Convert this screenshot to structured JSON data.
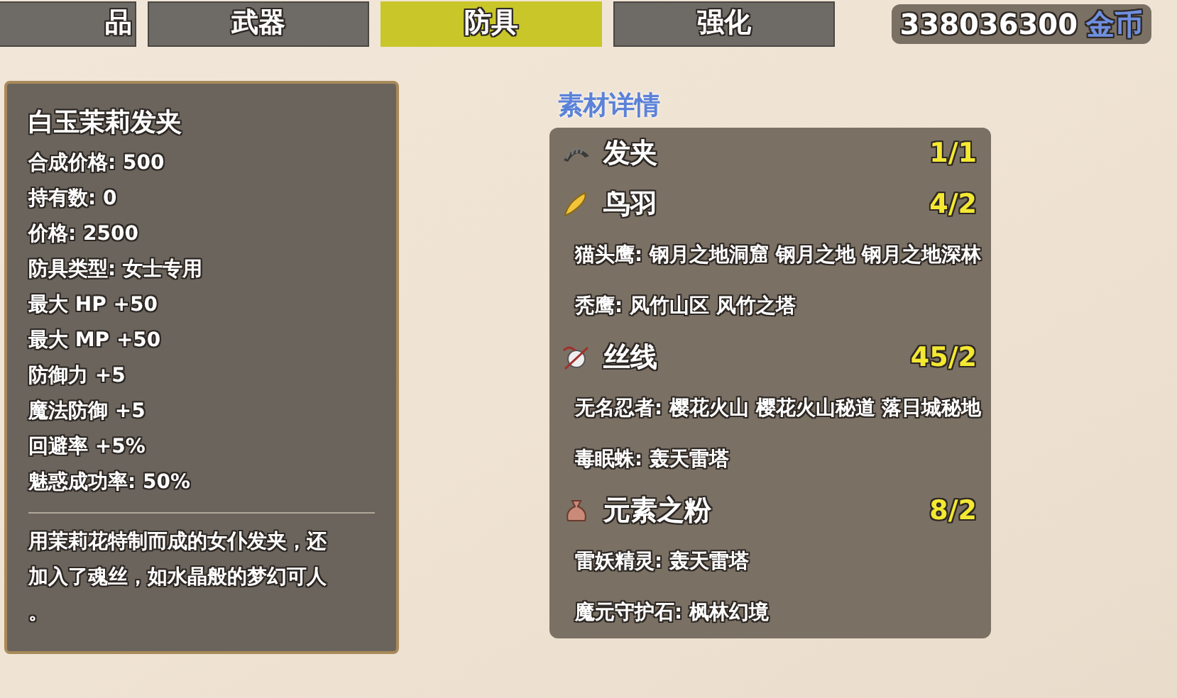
{
  "tabs": [
    {
      "label": "品",
      "selected": false
    },
    {
      "label": "武器",
      "selected": false
    },
    {
      "label": "防具",
      "selected": true
    },
    {
      "label": "强化",
      "selected": false
    }
  ],
  "gold": {
    "amount": "338036300",
    "unit": "金币"
  },
  "item": {
    "name": "白玉茉莉发夹",
    "stats": [
      "合成价格: 500",
      "持有数: 0",
      "价格: 2500",
      "防具类型: 女士专用",
      "最大 HP +50",
      "最大 MP +50",
      "防御力 +5",
      "魔法防御 +5",
      "回避率 +5%",
      "魅惑成功率: 50%"
    ],
    "description": "用茉莉花特制而成的女仆发夹，还加入了魂丝，如水晶般的梦幻可人。"
  },
  "materials": {
    "title": "素材详情",
    "items": [
      {
        "kind": "hairpin",
        "name": "发夹",
        "count": "1/1"
      },
      {
        "kind": "feather",
        "name": "鸟羽",
        "count": "4/2",
        "sources": [
          "猫头鹰: 钢月之地洞窟 钢月之地 钢月之地深林",
          "秃鹰: 风竹山区 风竹之塔"
        ]
      },
      {
        "kind": "thread",
        "name": "丝线",
        "count": "45/2",
        "sources": [
          "无名忍者: 樱花火山 樱花火山秘道 落日城秘地",
          "毒眠蛛: 轰天雷塔"
        ]
      },
      {
        "kind": "pouch",
        "name": "元素之粉",
        "count": "8/2",
        "sources": [
          "雷妖精灵: 轰天雷塔",
          "魔元守护石: 枫林幻境"
        ]
      }
    ]
  }
}
